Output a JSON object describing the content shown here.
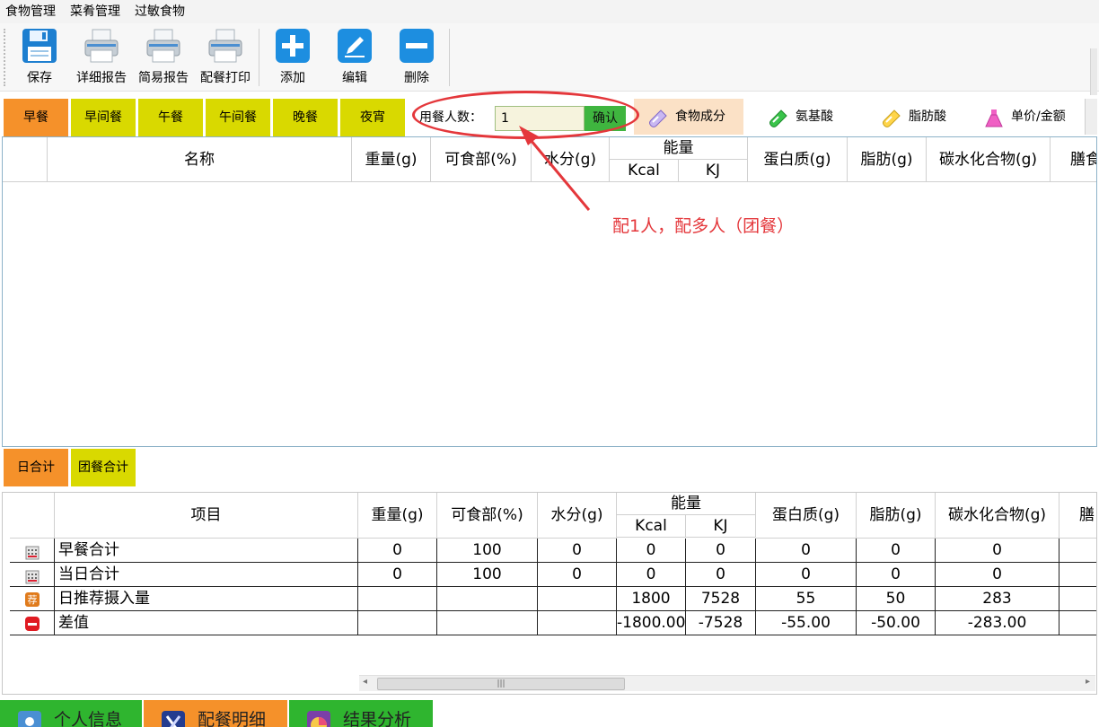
{
  "menu": [
    "食物管理",
    "菜肴管理",
    "过敏食物"
  ],
  "toolbar": {
    "save": "保存",
    "detail_report": "详细报告",
    "simple_report": "简易报告",
    "meal_print": "配餐打印",
    "add": "添加",
    "edit": "编辑",
    "delete": "删除"
  },
  "meals": [
    "早餐",
    "早间餐",
    "午餐",
    "午间餐",
    "晚餐",
    "夜宵"
  ],
  "active_meal": "早餐",
  "diners": {
    "label": "用餐人数：",
    "value": "1",
    "confirm": "确认"
  },
  "categories": [
    "食物成分",
    "氨基酸",
    "脂肪酸",
    "单价/金额"
  ],
  "food_table": {
    "columns": [
      "名称",
      "重量(g)",
      "可食部(%)",
      "水分(g)",
      "能量",
      "Kcal",
      "KJ",
      "蛋白质(g)",
      "脂肪(g)",
      "碳水化合物(g)",
      "膳食"
    ],
    "rows": []
  },
  "totals_tabs": [
    "日合计",
    "团餐合计"
  ],
  "totals_table": {
    "columns": [
      "项目",
      "重量(g)",
      "可食部(%)",
      "水分(g)",
      "能量",
      "Kcal",
      "KJ",
      "蛋白质(g)",
      "脂肪(g)",
      "碳水化合物(g)",
      "膳"
    ],
    "rows": [
      {
        "icon": "table-icon",
        "item": "早餐合计",
        "weight": "0",
        "edible": "100",
        "water": "0",
        "kcal": "0",
        "kj": "0",
        "protein": "0",
        "fat": "0",
        "carb": "0"
      },
      {
        "icon": "table-icon",
        "item": "当日合计",
        "weight": "0",
        "edible": "100",
        "water": "0",
        "kcal": "0",
        "kj": "0",
        "protein": "0",
        "fat": "0",
        "carb": "0"
      },
      {
        "icon": "recommend-icon",
        "item": "日推荐摄入量",
        "weight": "",
        "edible": "",
        "water": "",
        "kcal": "1800",
        "kj": "7528",
        "protein": "55",
        "fat": "50",
        "carb": "283"
      },
      {
        "icon": "minus-icon",
        "item": "差值",
        "weight": "",
        "edible": "",
        "water": "",
        "kcal": "-1800.00",
        "kj": "-7528",
        "protein": "-55.00",
        "fat": "-50.00",
        "carb": "-283.00"
      }
    ]
  },
  "bottom_nav": [
    "个人信息",
    "配餐明细",
    "结果分析"
  ],
  "annotation": "配1人，配多人（团餐）",
  "colors": {
    "active_tab": "#f5912a",
    "inactive_tab": "#d9d900",
    "annotation": "#e4373b",
    "confirm": "#3fb53f"
  }
}
